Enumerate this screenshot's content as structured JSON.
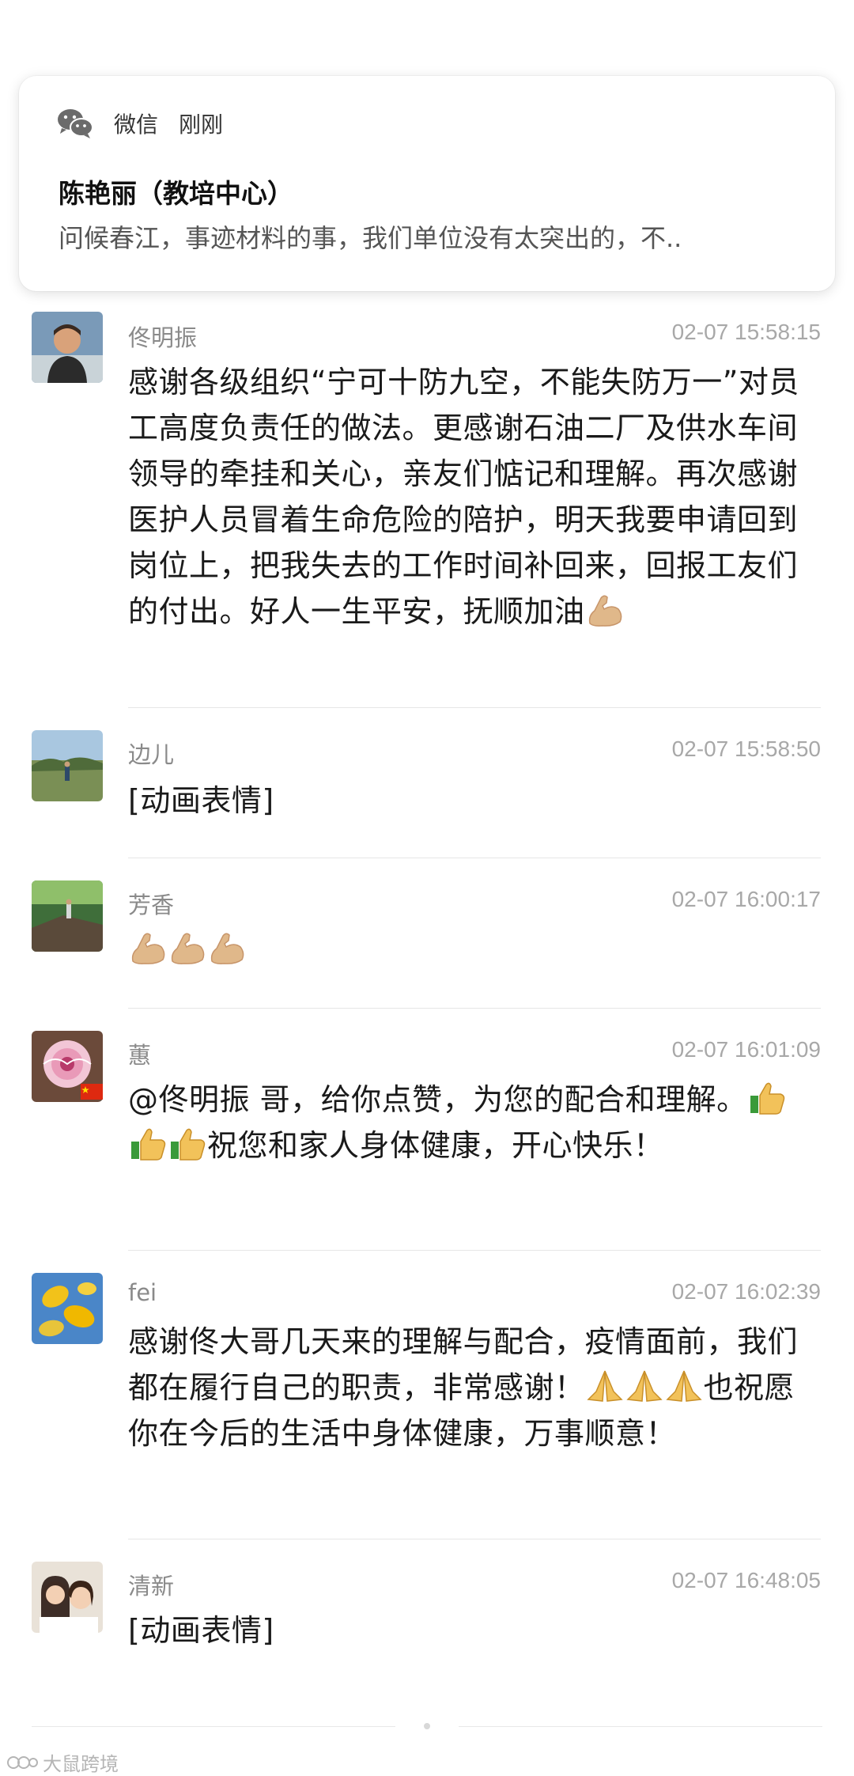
{
  "notification": {
    "app_icon": "wechat-icon",
    "app_name": "微信",
    "time": "刚刚",
    "sender": "陈艳丽（教培中心）",
    "preview": "问候春江，事迹材料的事，我们单位没有太突出的，不.."
  },
  "comments": [
    {
      "name": "佟明振",
      "time": "02-07 15:58:15",
      "text": "感谢各级组织“宁可十防九空，不能失防万一”对员工高度负责任的做法。更感谢石油二厂及供水车间领导的牵挂和关心，亲友们惦记和理解。再次感谢医护人员冒着生命危险的陪护，明天我要申请回到岗位上，把我失去的工作时间补回来，回报工友们的付出。好人一生平安，抚顺加油",
      "trailing_emoji": "flexed-biceps-emoji"
    },
    {
      "name": "边儿",
      "time": "02-07 15:58:50",
      "text": "[动画表情]"
    },
    {
      "name": "芳香",
      "time": "02-07 16:00:17",
      "emojis": [
        "flexed-biceps-emoji",
        "flexed-biceps-emoji",
        "flexed-biceps-emoji"
      ]
    },
    {
      "name": "蕙",
      "time": "02-07 16:01:09",
      "text_a": "@佟明振 哥，给你点赞，为您的配合和理解。",
      "emojis": [
        "thumbs-up-emoji",
        "thumbs-up-emoji",
        "thumbs-up-emoji"
      ],
      "text_b": "祝您和家人身体健康，开心快乐！",
      "badge": "china-flag-icon"
    },
    {
      "name": "fei",
      "time": "02-07 16:02:39",
      "text_a": "感谢佟大哥几天来的理解与配合，疫情面前，我们都在履行自己的职责，非常感谢！",
      "emojis": [
        "folded-hands-emoji",
        "folded-hands-emoji",
        "folded-hands-emoji"
      ],
      "text_b": "也祝愿你在今后的生活中身体健康，万事顺意！"
    },
    {
      "name": "清新",
      "time": "02-07 16:48:05",
      "text": "[动画表情]"
    }
  ],
  "watermark": "大鼠跨境",
  "colors": {
    "name": "#8a8a8a",
    "time": "#a8a8a8",
    "text": "#1a1a1a",
    "divider": "#e6e6e6"
  }
}
